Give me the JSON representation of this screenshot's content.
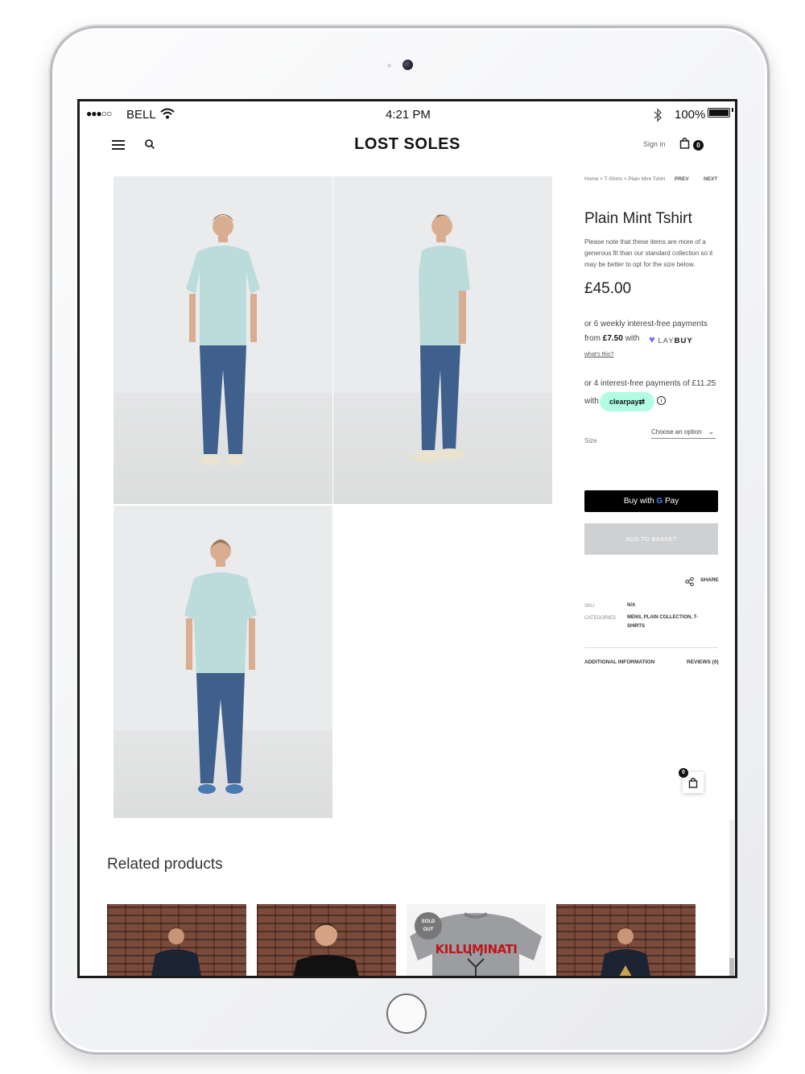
{
  "status_bar": {
    "signal_dots": "●●●○○",
    "carrier": "BELL",
    "time": "4:21 PM",
    "battery_percent": "100%",
    "icons": [
      "wifi-icon",
      "bluetooth-icon",
      "battery-icon"
    ]
  },
  "header": {
    "logo": "LOST SOLES",
    "sign_in": "Sign in",
    "basket_count": "0",
    "icons": [
      "menu-icon",
      "search-icon",
      "bag-icon"
    ]
  },
  "product": {
    "breadcrumb": "Home  >  T-Shirts  >  Plain Mint Tshirt",
    "prev": "PREV",
    "next": "NEXT",
    "title": "Plain Mint Tshirt",
    "note": "Please note that these items are more of a generous fit than our standard collection so it may be better to opt for the size below.",
    "price": "£45.00",
    "laybuy": {
      "line1": "or 6 weekly interest-free payments",
      "from_text": "from ",
      "amount": "£7.50",
      "with_text": " with",
      "logo_lay": "LAY",
      "logo_buy": "BUY",
      "whats_this": "what's this?"
    },
    "clearpay": {
      "line1": "or 4 interest-free payments of £11.25",
      "with_text": "with",
      "badge": "clearpay⇄"
    },
    "size": {
      "label": "Size",
      "select_value": "Choose an option"
    },
    "gpay_button": {
      "prefix": "Buy with ",
      "g": "G",
      "suffix": " Pay"
    },
    "add_to_basket": "ADD TO BASKET",
    "share": "SHARE",
    "meta": {
      "sku_key": "SKU",
      "sku_val": "N/A",
      "cat_key": "CATEGORIES",
      "cat_val": "MENS, PLAIN COLLECTION, T-SHIRTS"
    },
    "tabs": [
      "ADDITIONAL INFORMATION",
      "REVIEWS (0)"
    ],
    "shirt_color": "#bcdcdc",
    "jeans_color": "#3f5f8c"
  },
  "floating_basket": {
    "count": "0"
  },
  "related": {
    "title": "Related products",
    "cards": [
      {
        "type": "model",
        "shirt_color": "#1c2434"
      },
      {
        "type": "model",
        "shirt_color": "#111111"
      },
      {
        "type": "shirt",
        "badge_line1": "SOLD",
        "badge_line2": "OUT",
        "print_text": "KILLUMINATI"
      },
      {
        "type": "model",
        "shirt_color": "#1c2434"
      }
    ]
  }
}
